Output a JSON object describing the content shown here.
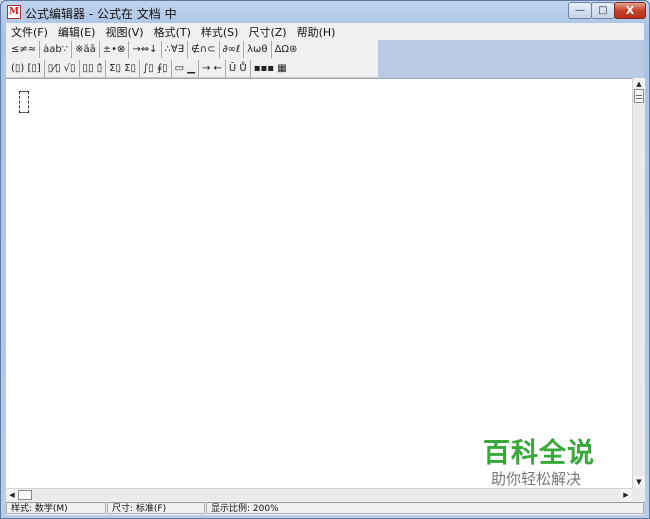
{
  "window": {
    "title": "公式编辑器 - 公式在 文档 中",
    "icon_label": "M",
    "controls": {
      "minimize": "—",
      "maximize": "□",
      "close": "X"
    }
  },
  "menu": {
    "items": [
      "文件(F)",
      "编辑(E)",
      "视图(V)",
      "格式(T)",
      "样式(S)",
      "尺寸(Z)",
      "帮助(H)"
    ]
  },
  "palette": {
    "row1": [
      "≤≠≈",
      "ȧab∵",
      "※äā",
      "±•⊗",
      "→⇔↓",
      "∴∀∃",
      "∉∩⊂",
      "∂∞ℓ",
      "λωθ",
      "ΔΩ⊛"
    ],
    "row2": [
      "(▯) [▯]",
      "▯⁄▯ √▯",
      "▯▯ ▯̂",
      "Σ▯ Σ▯",
      "∫▯ ∮▯",
      "▭ ▁",
      "→ ←",
      "Ū Ů",
      "▪▪▪ ▦"
    ]
  },
  "scroll": {
    "up": "▲",
    "down": "▼",
    "left": "◀",
    "right": "▶"
  },
  "status": {
    "style": "样式: 数学(M)",
    "size": "尺寸: 标准(F)",
    "zoom": "显示比例: 200%"
  },
  "watermark": {
    "title": "百科全说",
    "subtitle": "助你轻松解决"
  }
}
